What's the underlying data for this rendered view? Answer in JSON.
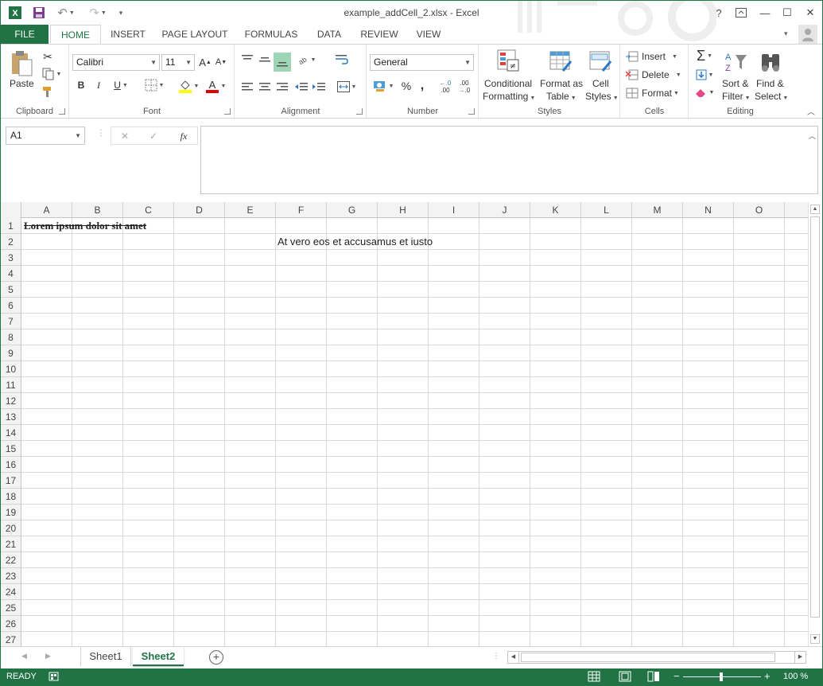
{
  "titlebar": {
    "title": "example_addCell_2.xlsx - Excel",
    "help": "?",
    "minimize": "—",
    "maximize": "☐",
    "close": "✕",
    "user": "👤"
  },
  "tabs": [
    "FILE",
    "HOME",
    "INSERT",
    "PAGE LAYOUT",
    "FORMULAS",
    "DATA",
    "REVIEW",
    "VIEW"
  ],
  "ribbon": {
    "clipboard": {
      "label": "Clipboard",
      "paste": "Paste"
    },
    "font": {
      "label": "Font",
      "name": "Calibri",
      "size": "11",
      "bold": "B",
      "italic": "I",
      "underline": "U",
      "grow": "A",
      "shrink": "A",
      "font_color": "A"
    },
    "alignment": {
      "label": "Alignment"
    },
    "number": {
      "label": "Number",
      "format": "General",
      "percent": "%",
      "comma": ",",
      "inc_decimal": ".00",
      "dec_decimal": ".0"
    },
    "styles": {
      "label": "Styles",
      "conditional_1": "Conditional",
      "conditional_2": "Formatting",
      "format_table_1": "Format as",
      "format_table_2": "Table",
      "cell_styles_1": "Cell",
      "cell_styles_2": "Styles"
    },
    "cells": {
      "label": "Cells",
      "insert": "Insert",
      "delete": "Delete",
      "format": "Format"
    },
    "editing": {
      "label": "Editing",
      "sort_1": "Sort &",
      "sort_2": "Filter",
      "find_1": "Find &",
      "find_2": "Select"
    }
  },
  "formula_bar": {
    "name_box": "A1",
    "cancel": "✕",
    "enter": "✓",
    "fx": "fx",
    "content": ""
  },
  "columns": [
    "A",
    "B",
    "C",
    "D",
    "E",
    "F",
    "G",
    "H",
    "I",
    "J",
    "K",
    "L",
    "M",
    "N",
    "O"
  ],
  "rows": [
    "1",
    "2",
    "3",
    "4",
    "5",
    "6",
    "7",
    "8",
    "9",
    "10",
    "11",
    "12",
    "13",
    "14",
    "15",
    "16",
    "17",
    "18",
    "19",
    "20",
    "21",
    "22",
    "23",
    "24",
    "25",
    "26",
    "27"
  ],
  "cells": {
    "A1": "Lorem ipsum dolor sit amet",
    "F2": "At vero eos et accusamus et iusto"
  },
  "sheets": [
    "Sheet1",
    "Sheet2"
  ],
  "active_sheet": "Sheet2",
  "status": {
    "ready": "READY",
    "zoom": "100 %",
    "zoom_out": "−",
    "zoom_in": "+"
  },
  "colors": {
    "accent": "#217346"
  }
}
